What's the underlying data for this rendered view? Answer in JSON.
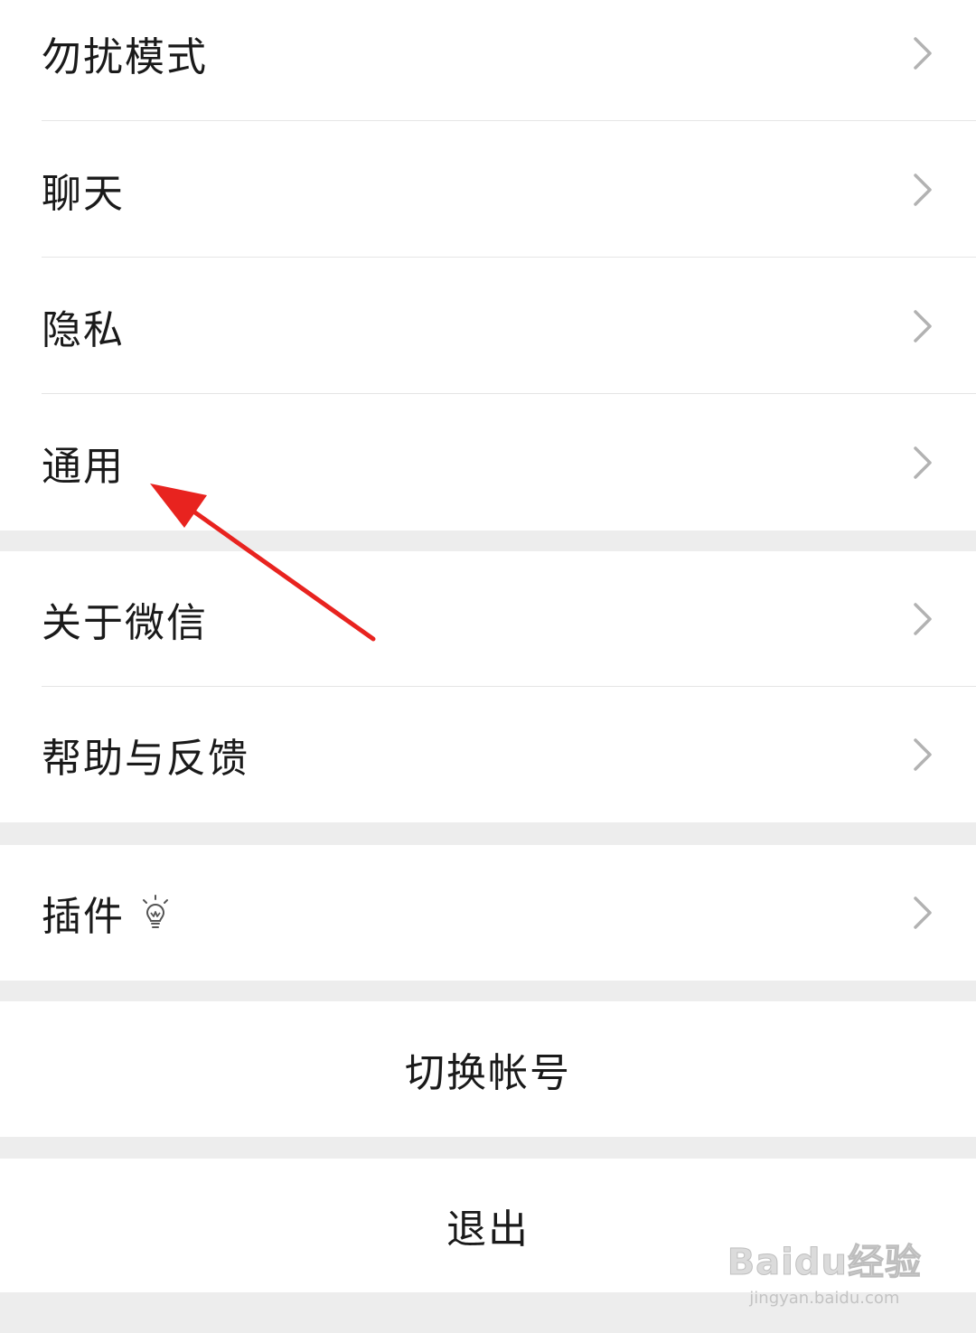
{
  "settings": {
    "group1": [
      {
        "label": "勿扰模式"
      },
      {
        "label": "聊天"
      },
      {
        "label": "隐私"
      },
      {
        "label": "通用"
      }
    ],
    "group2": [
      {
        "label": "关于微信"
      },
      {
        "label": "帮助与反馈"
      }
    ],
    "group3": [
      {
        "label": "插件",
        "icon": "lightbulb-icon"
      }
    ],
    "switch_account_label": "切换帐号",
    "logout_label": "退出"
  },
  "annotation": {
    "arrow_color": "#e8231f",
    "points_to": "通用"
  },
  "watermark": {
    "logo_text": "Baidu经验",
    "url_text": "jingyan.baidu.com"
  },
  "colors": {
    "background": "#ededed",
    "cell": "#ffffff",
    "text": "#1a1a1a",
    "chevron": "#b2b2b2"
  }
}
